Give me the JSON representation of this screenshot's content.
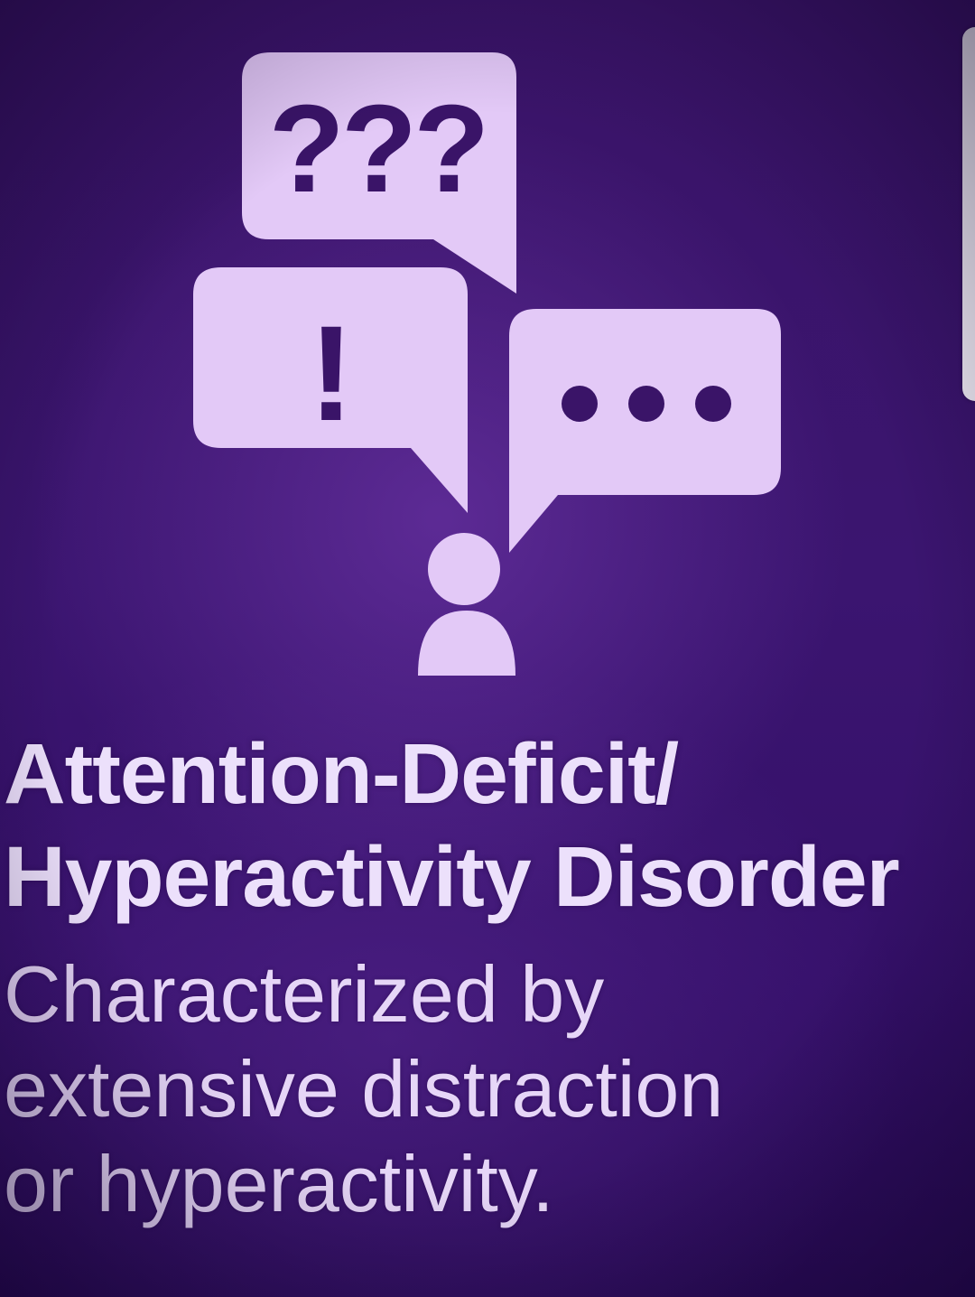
{
  "illustration": {
    "bubble_question_text": "???",
    "bubble_exclaim_text": "!",
    "bubble_color": "#e3c9f7",
    "bubble_text_color": "#3a1468"
  },
  "heading": {
    "line1": "Attention-Deficit/",
    "line2": "Hyperactivity Disorder"
  },
  "description": {
    "line1": "Characterized by",
    "line2": "extensive distraction",
    "line3": "or hyperactivity."
  },
  "colors": {
    "background": "#3a1468",
    "text": "#ece0fb"
  }
}
